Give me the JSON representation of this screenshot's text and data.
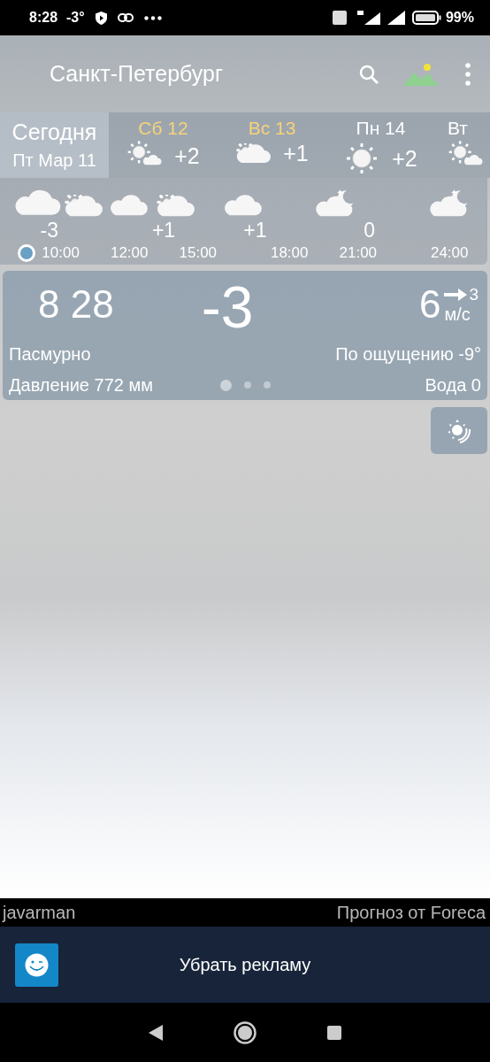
{
  "status_bar": {
    "time": "8:28",
    "temperature": "-3°",
    "battery": "99%"
  },
  "toolbar": {
    "title": "Санкт-Петербург"
  },
  "days": [
    {
      "label": "Сегодня",
      "date": "Пт Мар 11",
      "selected": true
    },
    {
      "label": "Сб 12",
      "temperature": "+2",
      "kind": "sun-cloud",
      "color": "#f7d27a",
      "selected": false
    },
    {
      "label": "Вс 13",
      "temperature": "+1",
      "kind": "cloud-sun",
      "color": "#f7d27a",
      "selected": false
    },
    {
      "label": "Пн 14",
      "temperature": "+2",
      "kind": "sun",
      "color": "#ffffff",
      "selected": false
    },
    {
      "label": "Вт",
      "kind": "sun-cloud",
      "color": "#ffffff",
      "selected": false
    }
  ],
  "hourly": {
    "icons": [
      {
        "kind": "cloud"
      },
      {
        "kind": "cloud-sun"
      },
      {
        "kind": "cloud"
      },
      {
        "kind": "cloud-sun"
      },
      {
        "kind": "cloud"
      },
      {
        "kind": "cloud-moon"
      },
      {
        "kind": "cloud-moon"
      }
    ],
    "temperatures": [
      "-3",
      "+1",
      "+1",
      "0"
    ],
    "times": [
      "10:00",
      "12:00",
      "15:00",
      "18:00",
      "21:00",
      "24:00"
    ]
  },
  "current": {
    "time": "8 28",
    "temperature": "-3",
    "wind_speed": "6",
    "wind_gust": "3",
    "wind_unit": "м/с",
    "condition": "Пасмурно",
    "feels_like": "По ощущению -9°",
    "pressure": "Давление 772 мм",
    "water": "Вода 0",
    "pages": [
      {
        "selected": true
      },
      {
        "selected": false
      },
      {
        "selected": false
      }
    ]
  },
  "credits": {
    "photo_author": "javarman",
    "forecast_source": "Прогноз от Foreca"
  },
  "ad_bar": {
    "label": "Убрать рекламу"
  }
}
